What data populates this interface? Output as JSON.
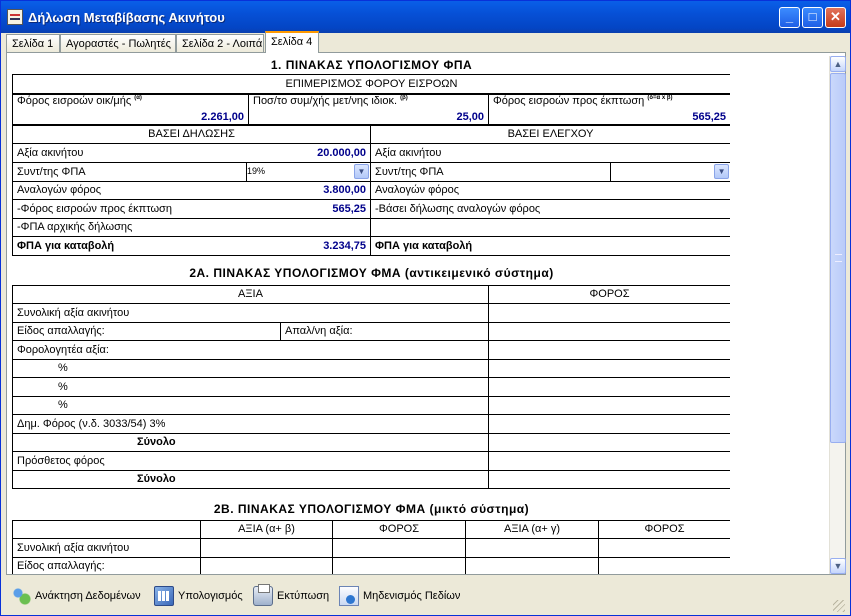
{
  "window": {
    "title": "Δήλωση Μεταβίβασης Ακινήτου",
    "min": "_",
    "max": "□",
    "close": "✕"
  },
  "tabs": [
    "Σελίδα 1",
    "Αγοραστές - Πωλητές",
    "Σελίδα 2 - Λοιπά",
    "Σελίδα 4"
  ],
  "sec1": {
    "title": "1. ΠΙΝΑΚΑΣ ΥΠΟΛΟΓΙΣΜΟΥ ΦΠΑ",
    "subtitle": "ΕΠΙΜΕΡΙΣΜΟΣ ΦΟΡΟΥ ΕΙΣΡΟΩΝ",
    "f1_label": "Φόρος εισροών οικ/μής",
    "f1_sup": "(α)",
    "f1_value": "2.261,00",
    "f2_label": "Ποσ/το συμ/χής μετ/νης ιδιοκ.",
    "f2_sup": "(β)",
    "f2_value": "25,00",
    "f3_label": "Φόρος εισροών προς έκπτωση",
    "f3_sup": "(δ=α x β)",
    "f3_value": "565,25",
    "left_header": "ΒΑΣΕΙ ΔΗΛΩΣΗΣ",
    "right_header": "ΒΑΣΕΙ ΕΛΕΓΧΟΥ",
    "l_axia": "Αξία ακινήτου",
    "l_axia_value": "20.000,00",
    "l_syntel": "Συντ/της ΦΠΑ",
    "l_syntel_value": "19%",
    "l_analog": "Αναλογών φόρος",
    "l_analog_value": "3.800,00",
    "l_ekpt": "-Φόρος εισροών προς έκπτωση",
    "l_ekpt_value": "565,25",
    "l_arx": "-ΦΠΑ αρχικής δήλωσης",
    "l_fpa": "ΦΠΑ για καταβολή",
    "l_fpa_value": "3.234,75",
    "r_axia": "Αξία ακινήτου",
    "r_syntel": "Συντ/της ΦΠΑ",
    "r_syntel_value": "",
    "r_analog": "Αναλογών φόρος",
    "r_vasei": "-Βάσει δήλωσης αναλογών φόρος",
    "r_fpa": "ΦΠΑ για καταβολή"
  },
  "sec2a": {
    "title": "2Α. ΠΙΝΑΚΑΣ ΥΠΟΛΟΓΙΣΜΟΥ ΦΜΑ (αντικειμενικό σύστημα)",
    "col_axia": "ΑΞΙΑ",
    "col_foros": "ΦΟΡΟΣ",
    "rows": {
      "synoliki": "Συνολική αξία ακινήτου",
      "eidos": "Είδος απαλλαγής:",
      "apallagi": "Απαλ/νη αξία:",
      "forologiteа": "Φορολογητέα αξία:",
      "p1": "%",
      "p2": "%",
      "p3": "%",
      "dim": "Δημ. Φόρος (ν.δ. 3033/54) 3%",
      "synolo1": "Σύνολο",
      "prosthetos": "Πρόσθετος φόρος",
      "synolo2": "Σύνολο"
    }
  },
  "sec2b": {
    "title": "2Β. ΠΙΝΑΚΑΣ ΥΠΟΛΟΓΙΣΜΟΥ ΦΜΑ (μικτό σύστημα)",
    "cols": [
      "ΑΞΙΑ (α+ β)",
      "ΦΟΡΟΣ",
      "ΑΞΙΑ (α+ γ)",
      "ΦΟΡΟΣ"
    ],
    "rows": {
      "synoliki": "Συνολική αξία ακινήτου",
      "eidos": "Είδος απαλλαγής:"
    }
  },
  "toolbar": {
    "load": "Ανάκτηση Δεδομένων",
    "calc": "Υπολογισμός",
    "print": "Εκτύπωση",
    "reset": "Μηδενισμός Πεδίων"
  }
}
